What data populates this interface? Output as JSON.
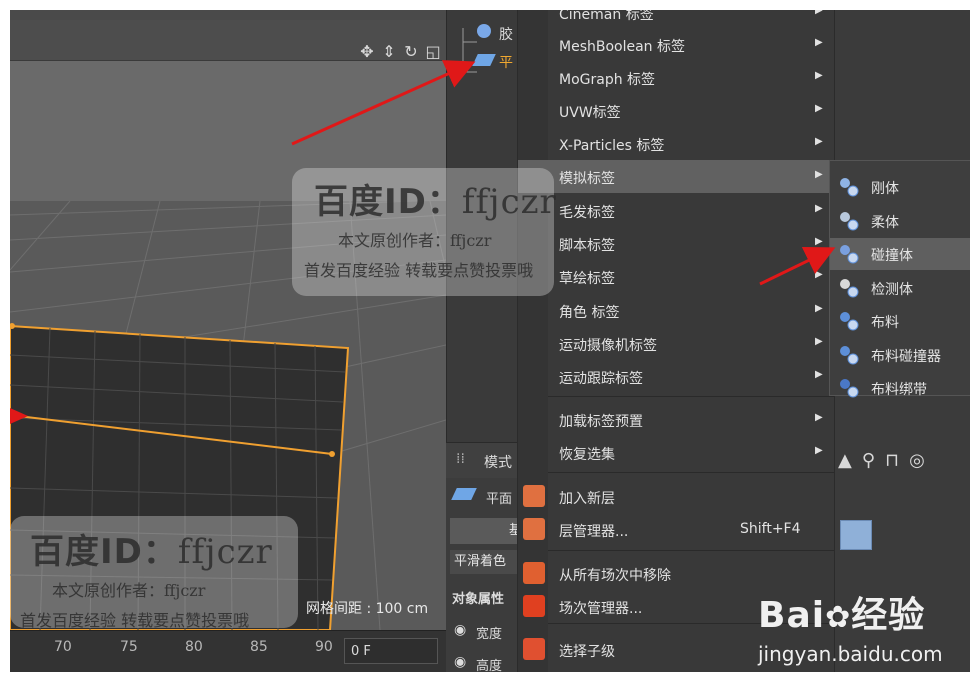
{
  "objects": [
    {
      "label": "胶",
      "color": "#d8d8d8"
    },
    {
      "label": "平",
      "color": "#f0a830"
    }
  ],
  "viewport": {
    "grid_spacing": "网格间距 : 100 cm",
    "ruler": [
      "70",
      "75",
      "80",
      "85",
      "90"
    ],
    "frame_field": "0 F"
  },
  "attributes": {
    "header": "模式",
    "object_name": "平面",
    "tab_basic": "基",
    "smooth_shading": "平滑着色",
    "object_props": "对象属性",
    "width": "宽度",
    "height": "高度"
  },
  "menu": {
    "items": [
      {
        "label": "Cineman 标签",
        "has_sub": true
      },
      {
        "label": "MeshBoolean 标签",
        "has_sub": true
      },
      {
        "label": "MoGraph 标签",
        "has_sub": true
      },
      {
        "label": "UVW标签",
        "has_sub": true
      },
      {
        "label": "X-Particles 标签",
        "has_sub": true
      },
      {
        "label": "模拟标签",
        "has_sub": true,
        "highlighted": true
      },
      {
        "label": "毛发标签",
        "has_sub": true
      },
      {
        "label": "脚本标签",
        "has_sub": true
      },
      {
        "label": "草绘标签",
        "has_sub": true
      },
      {
        "label": "角色 标签",
        "has_sub": true
      },
      {
        "label": "运动摄像机标签",
        "has_sub": true
      },
      {
        "label": "运动跟踪标签",
        "has_sub": true
      },
      {
        "label": "加载标签预置",
        "has_sub": true
      },
      {
        "label": "恢复选集",
        "has_sub": true
      },
      {
        "label": "加入新层",
        "icon_color": "#e07040"
      },
      {
        "label": "层管理器...",
        "shortcut": "Shift+F4",
        "icon_color": "#e07040"
      },
      {
        "label": "从所有场次中移除",
        "icon_color": "#e06030"
      },
      {
        "label": "场次管理器...",
        "icon_color": "#e04020"
      },
      {
        "label": "选择子级",
        "icon_color": "#e05030"
      }
    ]
  },
  "submenu": {
    "items": [
      {
        "label": "刚体"
      },
      {
        "label": "柔体"
      },
      {
        "label": "碰撞体",
        "highlighted": true
      },
      {
        "label": "检测体"
      },
      {
        "label": "布料"
      },
      {
        "label": "布料碰撞器"
      },
      {
        "label": "布料绑带"
      }
    ]
  },
  "watermark": {
    "title_a": "百度ID：",
    "title_b": "ffjczr",
    "line1": "本文原创作者：ffjczr",
    "line2": "首发百度经验 转载要点赞投票哦"
  },
  "baidu": {
    "brand": "Bai",
    "brand_tail": "经验",
    "url": "jingyan.baidu.com"
  },
  "colors": {
    "arrow": "#e01818",
    "plane_edge": "#f0a030",
    "highlight": "#616161"
  }
}
